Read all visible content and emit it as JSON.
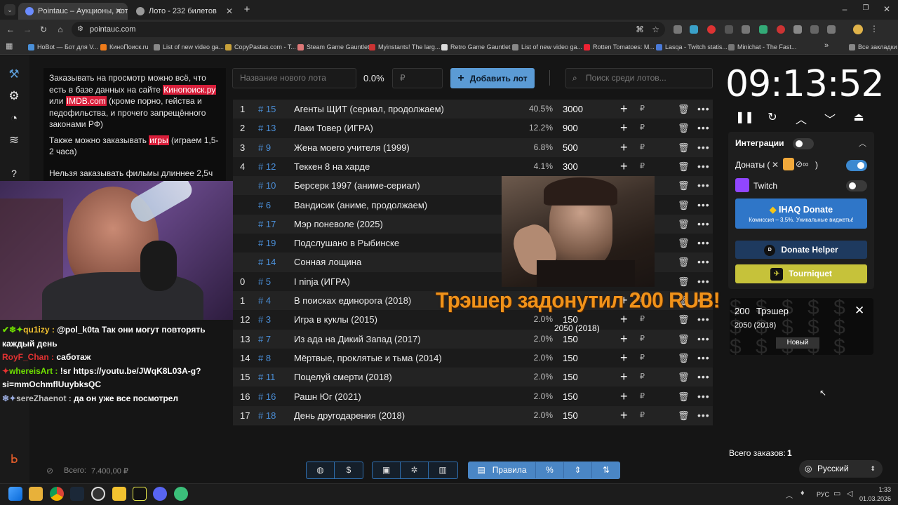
{
  "browser": {
    "tabs": [
      {
        "title": "Pointauc – Аукционы, лотереи"
      },
      {
        "title": "Лото - 232 билетов"
      }
    ],
    "url": "pointauc.com",
    "bookmarks": [
      "HoBot — Бот для V...",
      "КиноПоиск.ru",
      "List of new video ga...",
      "CopyPastas.com - T...",
      "Steam Game Gauntlet",
      "Myinstants! The larg...",
      "Retro Game Gauntlet",
      "List of new video ga...",
      "Rotten Tomatoes: M...",
      "Lasqa - Twitch statis...",
      "Minichat - The Fast..."
    ],
    "all_bookmarks": "Все закладки"
  },
  "rules": {
    "p1_a": "Заказывать на просмотр можно всё, что есть в базе данных на сайте ",
    "kinopoisk": "Кинопоиск.ру",
    "p1_b": " или ",
    "imdb": "IMDB.com",
    "p1_c": " (кроме порно, гейства и педофильства, и прочего запрещённого законами РФ)",
    "p2_a": "Также можно заказывать ",
    "games": "игры",
    "p2_b": " (играем 1,5-2 часа)",
    "p3": "Нельзя заказывать фильмы длиннее 2,5ч"
  },
  "chat": [
    {
      "user": "qu1izy",
      "text": "@pol_k0ta Так они могут повторять каждый день"
    },
    {
      "user": "RoyF_Chan",
      "text": "саботаж"
    },
    {
      "user": "whereisArt",
      "text": "!sr https://youtu.be/JWqK8L03A-g?si=mmOchmflUuybksQC"
    },
    {
      "user": "sereZhaenot",
      "text": "да он уже все посмотрел"
    }
  ],
  "controls": {
    "new_lot_placeholder": "Название нового лота",
    "percent": "0.0%",
    "amount_placeholder": "₽",
    "add_button": "Добавить лот",
    "search_placeholder": "Поиск среди лотов..."
  },
  "lots": [
    {
      "n": "1",
      "id": "# 15",
      "title": "Агенты ЩИТ (сериал, продолжаем)",
      "pct": "40.5%",
      "amount": "3000"
    },
    {
      "n": "2",
      "id": "# 13",
      "title": "Лаки Товер (ИГРА)",
      "pct": "12.2%",
      "amount": "900"
    },
    {
      "n": "3",
      "id": "# 9",
      "title": "Жена моего учителя (1999)",
      "pct": "6.8%",
      "amount": "500"
    },
    {
      "n": "4",
      "id": "# 12",
      "title": "Теккен 8 на харде",
      "pct": "4.1%",
      "amount": "300"
    },
    {
      "n": "",
      "id": "# 10",
      "title": "Берсерк 1997 (аниме-сериал)",
      "pct": "",
      "amount": ""
    },
    {
      "n": "",
      "id": "# 6",
      "title": "Вандисик (аниме, продолжаем)",
      "pct": "",
      "amount": ""
    },
    {
      "n": "",
      "id": "# 17",
      "title": "Мэр поневоле (2025)",
      "pct": "",
      "amount": ""
    },
    {
      "n": "",
      "id": "# 19",
      "title": "Подслушано в Рыбинске",
      "pct": "",
      "amount": ""
    },
    {
      "n": "",
      "id": "# 14",
      "title": "Сонная лощина",
      "pct": "",
      "amount": ""
    },
    {
      "n": "0",
      "id": "# 5",
      "title": "I ninja (ИГРА)",
      "pct": "",
      "amount": ""
    },
    {
      "n": "1",
      "id": "# 4",
      "title": "В поисках единорога (2018)",
      "pct": "",
      "amount": ""
    },
    {
      "n": "12",
      "id": "# 3",
      "title": "Игра в куклы (2015)",
      "pct": "2.0%",
      "amount": "150"
    },
    {
      "n": "13",
      "id": "# 7",
      "title": "Из ада на Дикий Запад (2017)",
      "pct": "2.0%",
      "amount": "150"
    },
    {
      "n": "14",
      "id": "# 8",
      "title": "Мёртвые, проклятые и тьма (2014)",
      "pct": "2.0%",
      "amount": "150"
    },
    {
      "n": "15",
      "id": "# 11",
      "title": "Поцелуй смерти (2018)",
      "pct": "2.0%",
      "amount": "150"
    },
    {
      "n": "16",
      "id": "# 16",
      "title": "Рашн Юг (2021)",
      "pct": "2.0%",
      "amount": "150"
    },
    {
      "n": "17",
      "id": "# 18",
      "title": "День другодарения (2018)",
      "pct": "2.0%",
      "amount": "150"
    }
  ],
  "currency": "₽",
  "overlay": {
    "donation_message": "Трэшер задонутил 200 RUB!",
    "caption": "2050 (2018)"
  },
  "timer": {
    "value": "09:13:52"
  },
  "integrations": {
    "title": "Интеграции",
    "donations_label": "Донаты (",
    "donations_close": ")",
    "twitch_label": "Twitch",
    "ihaq_title": "IHAQ Donate",
    "ihaq_sub": "Комиссия – 3,5%. Уникальные виджеты!",
    "donate_helper": "Donate Helper",
    "tourniquet": "Tourniquet"
  },
  "new_donation": {
    "amount": "200",
    "name": "Трэшер",
    "title": "2050 (2018)",
    "badge": "Новый"
  },
  "footer": {
    "total_label": "Всего:",
    "total_value": "7.400,00 ₽",
    "orders_label": "Всего заказов:",
    "orders_value": "1",
    "rules_button": "Правила",
    "language": "Русский"
  },
  "taskbar": {
    "lang": "РУС",
    "time": "1:33",
    "date": "01.03.2026"
  },
  "colors": {
    "accent": "#5b9bd5",
    "twitch": "#9146ff",
    "ihaq": "#2f76c8",
    "tourniquet": "#c6c23a"
  }
}
